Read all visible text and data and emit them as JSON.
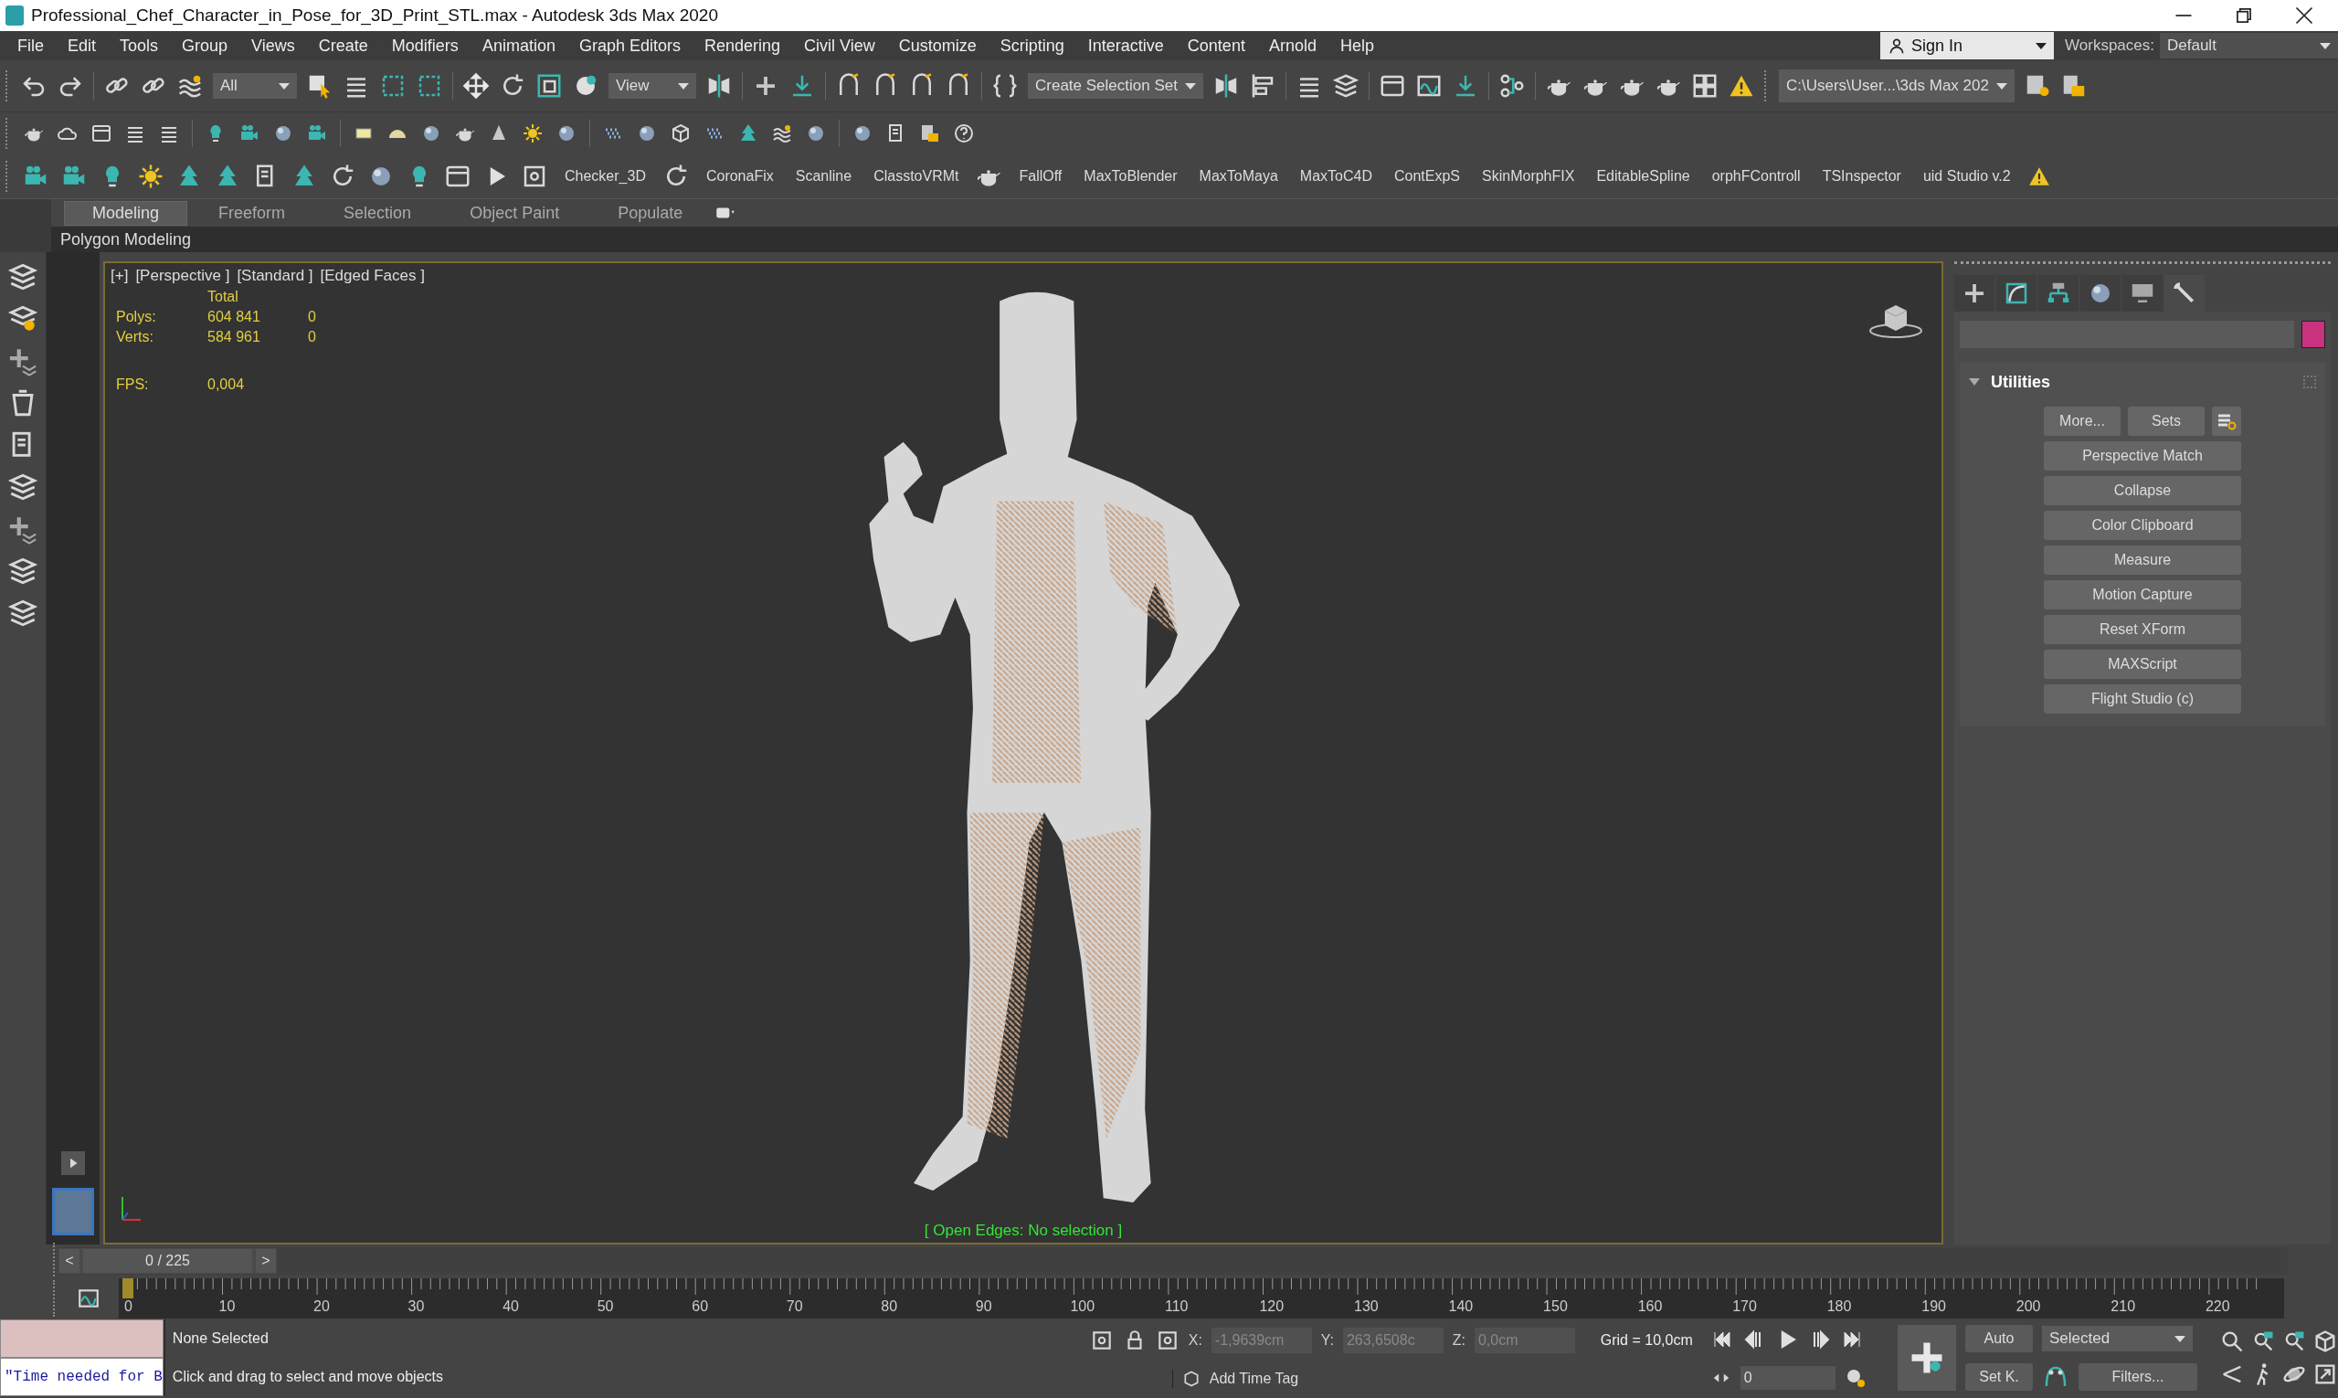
{
  "window": {
    "title": "Professional_Chef_Character_in_Pose_for_3D_Print_STL.max - Autodesk 3ds Max 2020"
  },
  "menu": [
    "File",
    "Edit",
    "Tools",
    "Group",
    "Views",
    "Create",
    "Modifiers",
    "Animation",
    "Graph Editors",
    "Rendering",
    "Civil View",
    "Customize",
    "Scripting",
    "Interactive",
    "Content",
    "Arnold",
    "Help"
  ],
  "account": {
    "sign_in": "Sign In",
    "workspaces_label": "Workspaces:",
    "workspace": "Default"
  },
  "main_toolbar": {
    "selection_filter": "All",
    "reference_coord": "View",
    "selection_set": "Create Selection Set",
    "project_path": "C:\\Users\\User...\\3ds Max 202"
  },
  "script_toolbar": [
    "Checker_3D",
    "CoronaFix",
    "Scanline",
    "ClasstoVRMt",
    "FallOff",
    "MaxToBlender",
    "MaxToMaya",
    "MaxToC4D",
    "ContExpS",
    "SkinMorphFIX",
    "EditableSpline",
    "orphFControll",
    "TSInspector",
    "uid Studio v.2"
  ],
  "ribbon": {
    "tabs": [
      {
        "label": "Modeling",
        "selected": true
      },
      {
        "label": "Freeform",
        "selected": false
      },
      {
        "label": "Selection",
        "selected": false
      },
      {
        "label": "Object Paint",
        "selected": false
      },
      {
        "label": "Populate",
        "selected": false
      }
    ],
    "panel": "Polygon Modeling"
  },
  "viewport": {
    "labels": [
      "[+]",
      "[Perspective ]",
      "[Standard ]",
      "[Edged Faces ]"
    ],
    "stats": {
      "header": "Total",
      "rows": [
        {
          "label": "Polys:",
          "total": "604 841",
          "selected": "0"
        },
        {
          "label": "Verts:",
          "total": "584 961",
          "selected": "0"
        }
      ],
      "fps_label": "FPS:",
      "fps": "0,004"
    },
    "message": "[ Open Edges: No selection ]"
  },
  "command_panel": {
    "tabs": [
      {
        "selected": false
      },
      {
        "selected": false
      },
      {
        "selected": false
      },
      {
        "selected": false
      },
      {
        "selected": false
      },
      {
        "selected": true
      }
    ],
    "rollout": {
      "title": "Utilities",
      "expanded": true,
      "top_buttons": [
        "More...",
        "Sets"
      ],
      "buttons": [
        "Perspective Match",
        "Collapse",
        "Color Clipboard",
        "Measure",
        "Motion Capture",
        "Reset XForm",
        "MAXScript",
        "Flight Studio (c)"
      ]
    }
  },
  "time_slider": {
    "prev": "<",
    "position": "0 / 225",
    "next": ">",
    "level": 0
  },
  "track_bar": {
    "ticks": [
      "0",
      "10",
      "20",
      "30",
      "40",
      "50",
      "60",
      "70",
      "80",
      "90",
      "100",
      "110",
      "120",
      "130",
      "140",
      "150",
      "160",
      "170",
      "180",
      "190",
      "200",
      "210",
      "220"
    ]
  },
  "status": {
    "listener": "\"Time needed for B",
    "selection": "None Selected",
    "prompt": "Click and drag to select and move objects",
    "x_label": "X:",
    "x": "-1,9639cm",
    "y_label": "Y:",
    "y": "263,6508c",
    "z_label": "Z:",
    "z": "0,0cm",
    "grid": "Grid = 10,0cm",
    "time_tag": "Add Time Tag",
    "frame": "0",
    "auto_key": "Auto",
    "set_key": "Set K.",
    "key_filter": "Selected",
    "filters": "Filters..."
  }
}
